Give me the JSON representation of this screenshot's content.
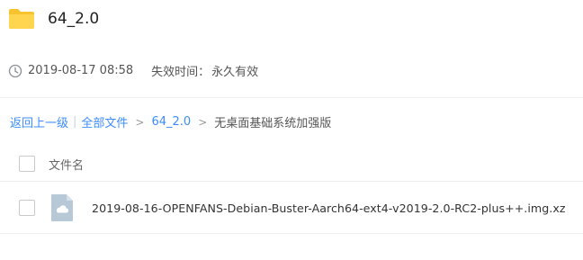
{
  "share": {
    "title": "64_2.0",
    "date": "2019-08-17 08:58",
    "expire_label": "失效时间：",
    "expire_value": "永久有效"
  },
  "breadcrumb": {
    "back_label": "返回上一级",
    "root_label": "全部文件",
    "folder_label": "64_2.0",
    "current_label": "无桌面基础系统加强版",
    "separator": ">"
  },
  "file_list": {
    "column_name": "文件名",
    "files": [
      {
        "name": "2019-08-16-OPENFANS-Debian-Buster-Aarch64-ext4-v2019-2.0-RC2-plus++.img.xz",
        "icon": "cloud-file-icon"
      }
    ]
  },
  "colors": {
    "folder": "#f7c430",
    "link": "#3b8cff",
    "file_icon": "#b7c8d6"
  }
}
